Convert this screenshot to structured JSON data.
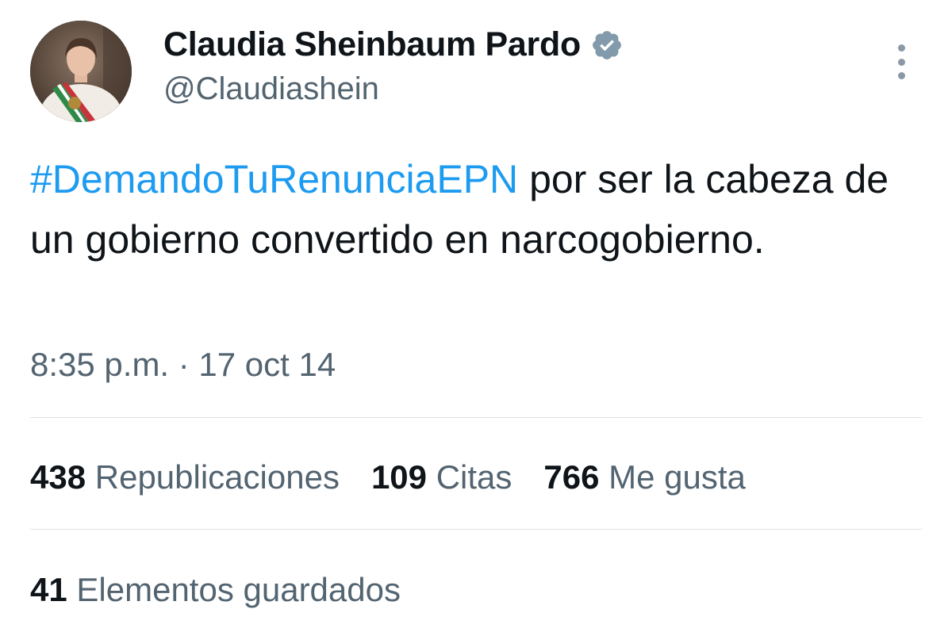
{
  "author": {
    "display_name": "Claudia Sheinbaum Pardo",
    "handle": "@Claudiashein",
    "verified": true
  },
  "tweet": {
    "hashtag": "#DemandoTuRenunciaEPN",
    "text": " por ser la cabeza de un gobierno convertido en narcogobierno.",
    "timestamp": "8:35 p.m. · 17 oct 14"
  },
  "stats": {
    "reposts": {
      "count": "438",
      "label": "Republicaciones"
    },
    "quotes": {
      "count": "109",
      "label": "Citas"
    },
    "likes": {
      "count": "766",
      "label": "Me gusta"
    },
    "bookmarks": {
      "count": "41",
      "label": "Elementos guardados"
    }
  },
  "colors": {
    "hashtag": "#1d9bf0",
    "secondary_text": "#536471",
    "verified_badge": "#829aab"
  },
  "icons": {
    "verified": "verified-badge-icon",
    "more": "more-options-icon"
  }
}
